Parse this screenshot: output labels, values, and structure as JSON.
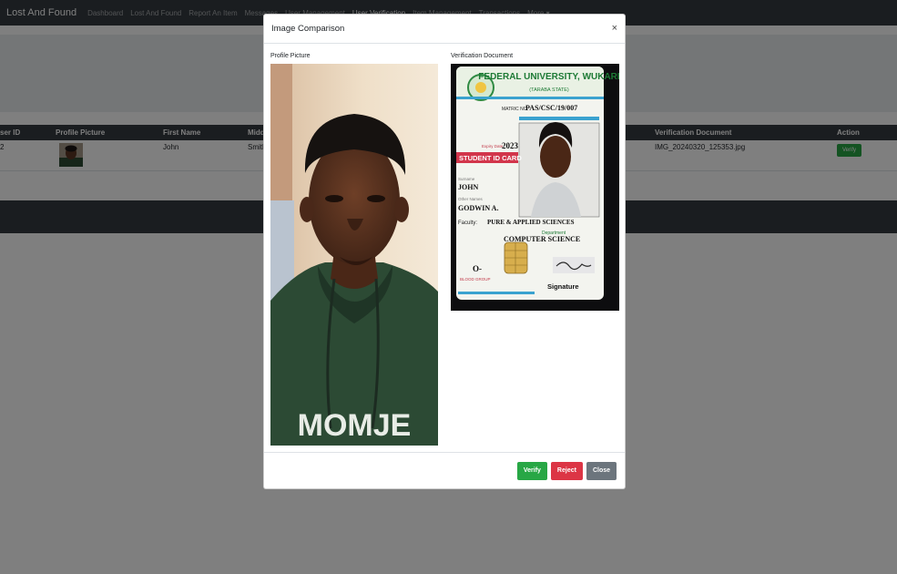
{
  "navbar": {
    "brand": "Lost And Found",
    "links": [
      "Dashboard",
      "Lost And Found",
      "Report An Item",
      "Messages",
      "User Management",
      "User Verification",
      "Item Management",
      "Transactions",
      "More ▾"
    ]
  },
  "table": {
    "headers": [
      "ser ID",
      "Profile Picture",
      "First Name",
      "Midd",
      "",
      "Verification Document",
      "Action"
    ],
    "row": {
      "id": "2",
      "first_name": "John",
      "middle_name": "Smith",
      "document": "IMG_20240320_125353.jpg",
      "action": "Verify"
    }
  },
  "modal": {
    "title": "Image Comparison",
    "close_symbol": "×",
    "profile_label": "Profile Picture",
    "document_label": "Verification Document",
    "buttons": {
      "verify": "Verify",
      "reject": "Reject",
      "close": "Close"
    }
  },
  "id_card": {
    "university": "FEDERAL UNIVERSITY, WUKARI",
    "state": "(TARABA STATE)",
    "matric_label": "MATRIC NO.",
    "matric_no": "PAS/CSC/19/007",
    "expiry_label": "Expiry Date",
    "expiry_year": "2023",
    "card_type": "STUDENT ID CARD",
    "surname_label": "Surname",
    "surname": "JOHN",
    "other_names_label": "Other Names",
    "other_names": "GODWIN A.",
    "faculty_label": "Faculty:",
    "faculty": "PURE & APPLIED SCIENCES",
    "department_label": "Department",
    "department": "COMPUTER SCIENCE",
    "blood_group": "O-",
    "blood_group_label": "BLOOD GROUP",
    "signature_label": "Signature"
  },
  "hoodie_print": "MOMJE"
}
